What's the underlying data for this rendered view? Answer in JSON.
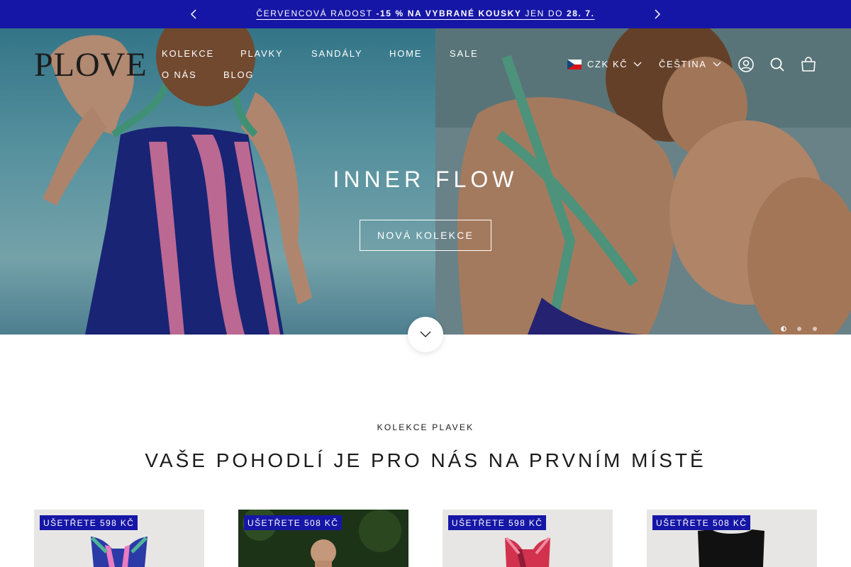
{
  "announcement": {
    "prev_label": "Předchozí",
    "next_label": "Další",
    "text_plain_1": "Červencová radost ",
    "text_bold_1": "-15 % na vybrané kousky",
    "text_plain_2": " jen do ",
    "text_bold_2": "28. 7."
  },
  "header": {
    "logo": "PLOVE",
    "nav": [
      "Kolekce",
      "Plavky",
      "Sandály",
      "Home",
      "Sale",
      "O nás",
      "Blog"
    ],
    "currency": "CZK Kč",
    "language": "Čeština",
    "icons": [
      "account-icon",
      "search-icon",
      "cart-icon"
    ]
  },
  "hero": {
    "title": "INNER FLOW",
    "button": "Nová kolekce",
    "slides": 3,
    "active_slide": 1
  },
  "section": {
    "subtitle": "Kolekce plavek",
    "title": "Vaše pohodlí je pro nás na prvním místě"
  },
  "products": [
    {
      "badge": "Ušetřete 598 Kč"
    },
    {
      "badge": "Ušetřete 508 Kč"
    },
    {
      "badge": "Ušetřete 598 Kč"
    },
    {
      "badge": "Ušetřete 508 Kč"
    }
  ],
  "colors": {
    "brand_blue": "#1616a6",
    "text": "#1c1c1c",
    "white": "#ffffff"
  }
}
